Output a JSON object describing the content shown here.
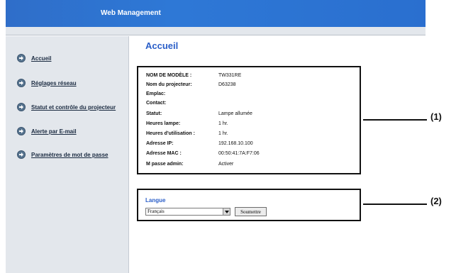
{
  "header": {
    "title": "Web Management"
  },
  "sidebar": {
    "items": [
      {
        "label": "Accueil"
      },
      {
        "label": "Réglages réseau"
      },
      {
        "label": "Statut et contrôle du projecteur"
      },
      {
        "label": "Alerte par E-mail"
      },
      {
        "label": "Paramètres de mot de passe"
      }
    ]
  },
  "main": {
    "title": "Accueil",
    "info": [
      {
        "label": "NOM DE MODÈLE :",
        "value": "TW331RE"
      },
      {
        "label": "Nom du projecteur:",
        "value": "D63238"
      },
      {
        "label": "Emplac:",
        "value": ""
      },
      {
        "label": "Contact:",
        "value": ""
      },
      {
        "label": "Statut:",
        "value": "Lampe allumée"
      },
      {
        "label": "Heures lampe:",
        "value": "1 hr."
      },
      {
        "label": "Heures d'utilisation :",
        "value": "1 hr."
      },
      {
        "label": "Adresse IP:",
        "value": "192.168.10.100"
      },
      {
        "label": "Adresse MAC :",
        "value": "00:50:41:7A:F7:06"
      },
      {
        "label": "M passe admin:",
        "value": "Activer"
      }
    ],
    "language": {
      "title": "Langue",
      "selected": "Français",
      "submit_label": "Soumettre"
    }
  },
  "callouts": {
    "first": "(1)",
    "second": "(2)"
  }
}
